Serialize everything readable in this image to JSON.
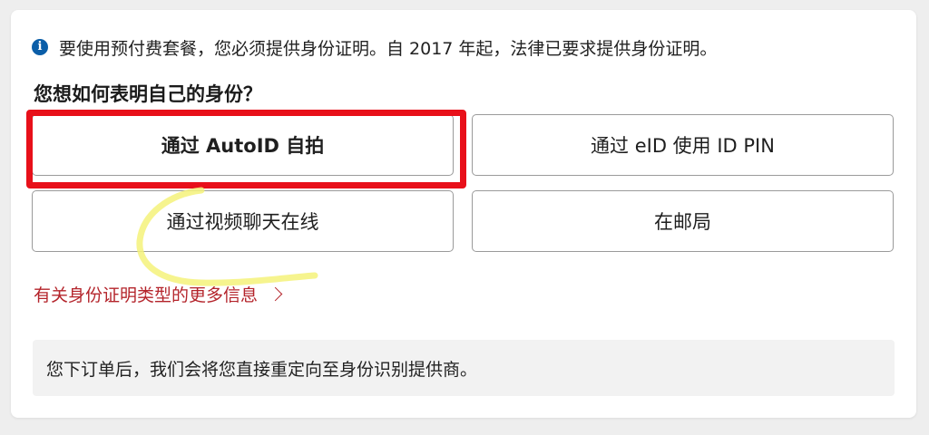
{
  "info": {
    "icon": "info-icon",
    "icon_glyph": "i",
    "text": "要使用预付费套餐，您必须提供身份证明。自 2017 年起，法律已要求提供身份证明。"
  },
  "question": "您想如何表明自己的身份？",
  "options": [
    {
      "label": "通过 AutoID 自拍",
      "highlighted": true
    },
    {
      "label": "通过 eID 使用 ID PIN"
    },
    {
      "label": "通过视频聊天在线"
    },
    {
      "label": "在邮局"
    }
  ],
  "more_link": {
    "label": "有关身份证明类型的更多信息",
    "icon": "chevron-right-icon"
  },
  "note": "您下订单后，我们会将您直接重定向至身份识别提供商。",
  "colors": {
    "info_icon": "#0b5ea8",
    "highlight": "#e8101a",
    "link": "#b4242b",
    "scribble": "#f4f27a"
  }
}
